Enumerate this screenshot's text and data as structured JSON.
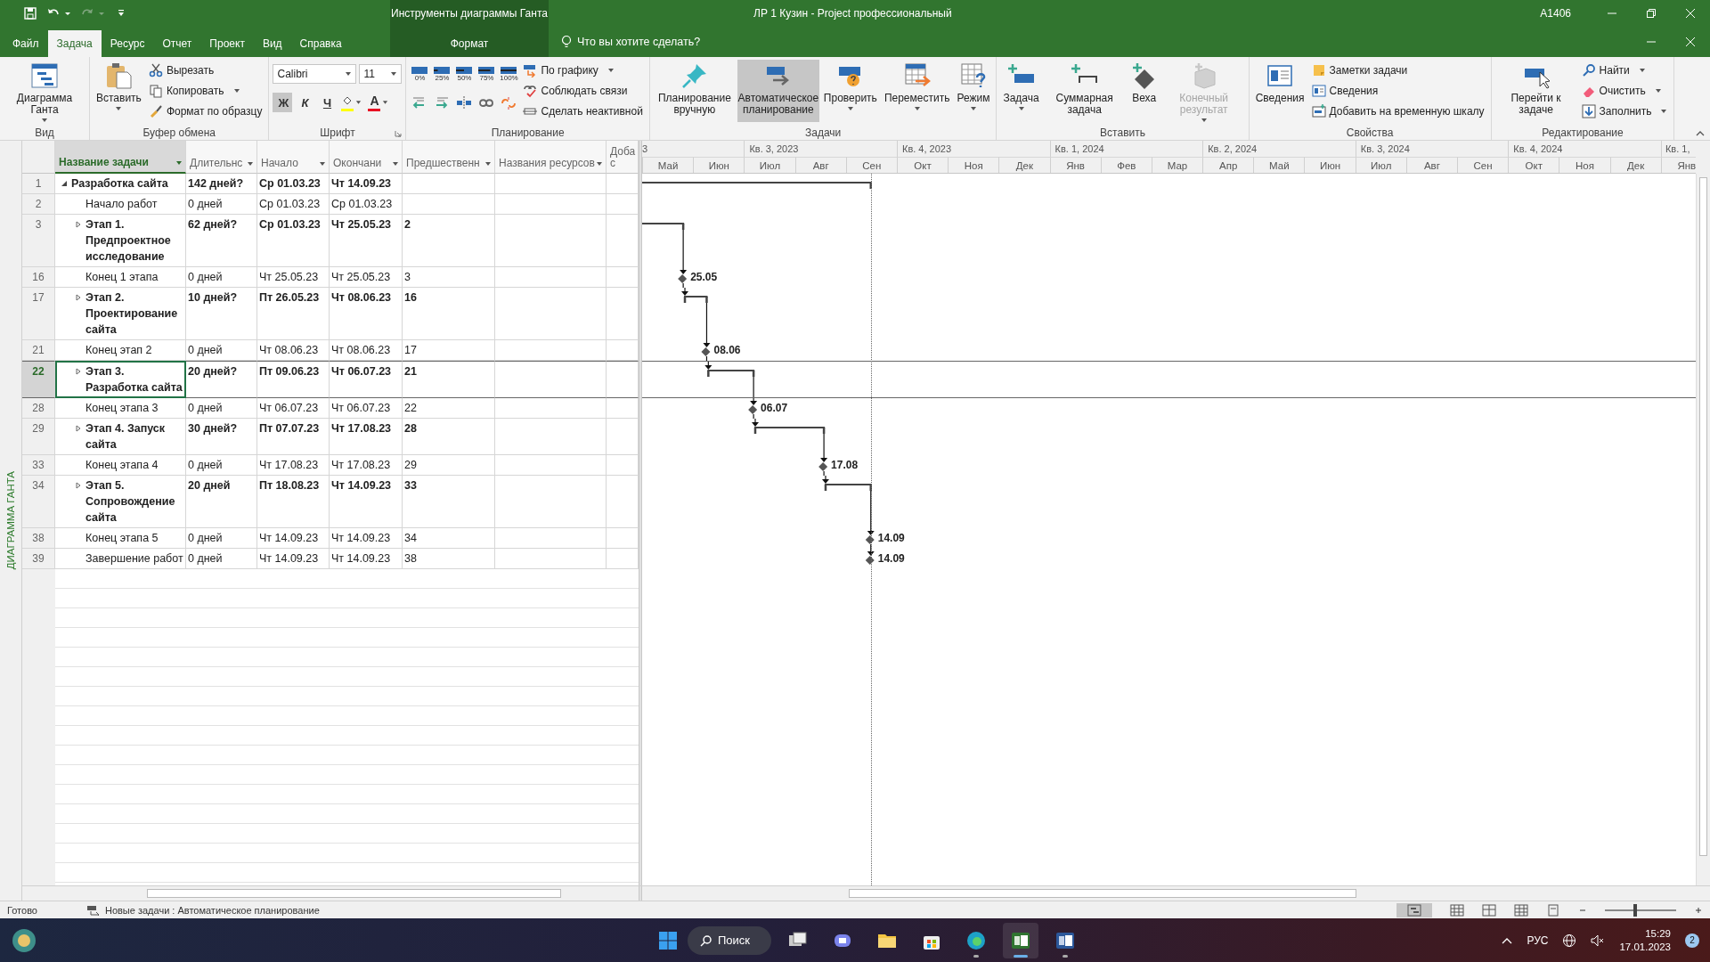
{
  "title_bar": {
    "context_group": "Инструменты диаграммы Ганта",
    "title": "ЛР 1 Кузин  -  Project профессиональный",
    "user": "A1406"
  },
  "tabs": [
    {
      "label": "Файл",
      "selected": false
    },
    {
      "label": "Задача",
      "selected": true
    },
    {
      "label": "Ресурс",
      "selected": false
    },
    {
      "label": "Отчет",
      "selected": false
    },
    {
      "label": "Проект",
      "selected": false
    },
    {
      "label": "Вид",
      "selected": false
    },
    {
      "label": "Справка",
      "selected": false
    }
  ],
  "context_tab": {
    "label": "Формат"
  },
  "tell_me": {
    "placeholder": "Что вы хотите сделать?"
  },
  "ribbon": {
    "groups": [
      {
        "label": "Вид",
        "items": [
          {
            "kind": "large",
            "label": "Диаграмма Ганта",
            "dropdown": true
          }
        ]
      },
      {
        "label": "Буфер обмена",
        "items": [
          {
            "kind": "large",
            "label": "Вставить",
            "dropdown": true
          },
          {
            "kind": "stack",
            "items": [
              {
                "kind": "small",
                "label": "Вырезать"
              },
              {
                "kind": "small",
                "label": "Копировать",
                "dropdown": true
              },
              {
                "kind": "small",
                "label": "Формат по образцу"
              }
            ]
          }
        ]
      },
      {
        "label": "Шрифт",
        "launcher": true,
        "items": [
          {
            "kind": "stack",
            "items": [
              {
                "kind": "row",
                "items": [
                  {
                    "kind": "combo",
                    "value": "Calibri"
                  },
                  {
                    "kind": "combo",
                    "value": "11"
                  }
                ]
              },
              {
                "kind": "row",
                "items": [
                  {
                    "kind": "toggle",
                    "label": "Ж",
                    "selected": true
                  },
                  {
                    "kind": "toggle",
                    "label": "К",
                    "selected": false
                  },
                  {
                    "kind": "toggle",
                    "label": "Ч",
                    "selected": false
                  },
                  {
                    "kind": "color",
                    "color": "#ffff00"
                  },
                  {
                    "kind": "color",
                    "label": "A",
                    "color": "#e81123"
                  }
                ]
              }
            ]
          }
        ]
      },
      {
        "label": "Планирование",
        "items": [
          {
            "kind": "stack",
            "items": [
              {
                "kind": "row",
                "items": [
                  {
                    "kind": "percent",
                    "label": "0%"
                  },
                  {
                    "kind": "percent",
                    "label": "25%"
                  },
                  {
                    "kind": "percent",
                    "label": "50%"
                  },
                  {
                    "kind": "percent",
                    "label": "75%"
                  },
                  {
                    "kind": "percent",
                    "label": "100%"
                  }
                ]
              },
              {
                "kind": "row",
                "items": [
                  {
                    "kind": "icon"
                  },
                  {
                    "kind": "icon"
                  },
                  {
                    "kind": "icon"
                  },
                  {
                    "kind": "icon"
                  },
                  {
                    "kind": "icon"
                  }
                ]
              }
            ]
          },
          {
            "kind": "stack",
            "items": [
              {
                "kind": "small",
                "label": "По графику",
                "dropdown": true
              },
              {
                "kind": "small",
                "label": "Соблюдать связи"
              },
              {
                "kind": "small",
                "label": "Сделать неактивной"
              }
            ]
          }
        ]
      },
      {
        "label": "Задачи",
        "items": [
          {
            "kind": "large",
            "label": "Планирование вручную",
            "selected": false
          },
          {
            "kind": "large",
            "label": "Автоматическое планирование",
            "selected": true
          },
          {
            "kind": "large",
            "label": "Проверить",
            "dropdown": true,
            "selected": false
          },
          {
            "kind": "large",
            "label": "Переместить",
            "dropdown": true,
            "selected": false
          },
          {
            "kind": "large",
            "label": "Режим",
            "dropdown": true,
            "selected": false
          }
        ]
      },
      {
        "label": "Вставить",
        "items": [
          {
            "kind": "large",
            "label": "Задача",
            "dropdown": true,
            "disabled": false
          },
          {
            "kind": "large",
            "label": "Суммарная задача",
            "disabled": false
          },
          {
            "kind": "large",
            "label": "Веха",
            "disabled": false
          },
          {
            "kind": "large",
            "label": "Конечный результат",
            "dropdown": true,
            "disabled": true
          }
        ]
      },
      {
        "label": "Свойства",
        "items": [
          {
            "kind": "large",
            "label": "Сведения"
          },
          {
            "kind": "stack",
            "items": [
              {
                "kind": "small",
                "label": "Заметки задачи"
              },
              {
                "kind": "small",
                "label": "Сведения"
              },
              {
                "kind": "small",
                "label": "Добавить на временную шкалу"
              }
            ]
          }
        ]
      },
      {
        "label": "Редактирование",
        "items": [
          {
            "kind": "large",
            "label": "Перейти к задаче"
          },
          {
            "kind": "stack",
            "items": [
              {
                "kind": "small",
                "label": "Найти",
                "dropdown": true
              },
              {
                "kind": "small",
                "label": "Очистить",
                "dropdown": true
              },
              {
                "kind": "small",
                "label": "Заполнить",
                "dropdown": true
              }
            ]
          }
        ]
      }
    ]
  },
  "view_bar": {
    "label": "ДИАГРАММА ГАНТА"
  },
  "table": {
    "columns": [
      {
        "label": "Название задачи",
        "selected": true,
        "dropdown": true
      },
      {
        "label": "Длительнс",
        "selected": false,
        "dropdown": true
      },
      {
        "label": "Начало",
        "selected": false,
        "dropdown": true
      },
      {
        "label": "Окончани",
        "selected": false,
        "dropdown": true
      },
      {
        "label": "Предшественн",
        "selected": false,
        "dropdown": true
      },
      {
        "label": "Названия ресурсов",
        "selected": false,
        "dropdown": true
      },
      {
        "label": "Доба с",
        "selected": false
      }
    ],
    "rows": [
      {
        "id": "1",
        "name": "Разработка сайта",
        "duration": "142 дней?",
        "start": "Ср 01.03.23",
        "finish": "Чт 14.09.23",
        "kind": "summary",
        "expanded": true,
        "selected": false,
        "children": [
          {
            "id": "2",
            "name": "Начало работ",
            "duration": "0 дней",
            "start": "Ср 01.03.23",
            "finish": "Ср 01.03.23",
            "kind": "milestone",
            "selected": false
          },
          {
            "id": "3",
            "name": "Этап 1. Предпроектное исследование",
            "duration": "62 дней?",
            "start": "Ср 01.03.23",
            "finish": "Чт 25.05.23",
            "predecessors": "2",
            "kind": "summary",
            "expanded": false,
            "selected": false
          },
          {
            "id": "16",
            "name": "Конец 1 этапа",
            "duration": "0 дней",
            "start": "Чт 25.05.23",
            "finish": "Чт 25.05.23",
            "predecessors": "3",
            "kind": "milestone",
            "gantt_label": "25.05",
            "selected": false
          },
          {
            "id": "17",
            "name": "Этап 2. Проектирование сайта",
            "duration": "10 дней?",
            "start": "Пт 26.05.23",
            "finish": "Чт 08.06.23",
            "predecessors": "16",
            "kind": "summary",
            "expanded": false,
            "selected": false
          },
          {
            "id": "21",
            "name": "Конец этап 2",
            "duration": "0 дней",
            "start": "Чт 08.06.23",
            "finish": "Чт 08.06.23",
            "predecessors": "17",
            "kind": "milestone",
            "gantt_label": "08.06",
            "selected": false
          },
          {
            "id": "22",
            "name": "Этап 3. Разработка сайта",
            "duration": "20 дней?",
            "start": "Пт 09.06.23",
            "finish": "Чт 06.07.23",
            "predecessors": "21",
            "kind": "summary",
            "expanded": false,
            "selected": true
          },
          {
            "id": "28",
            "name": "Конец этапа 3",
            "duration": "0 дней",
            "start": "Чт 06.07.23",
            "finish": "Чт 06.07.23",
            "predecessors": "22",
            "kind": "milestone",
            "gantt_label": "06.07",
            "selected": false
          },
          {
            "id": "29",
            "name": "Этап 4. Запуск сайта",
            "duration": "30 дней?",
            "start": "Пт 07.07.23",
            "finish": "Чт 17.08.23",
            "predecessors": "28",
            "kind": "summary",
            "expanded": false,
            "selected": false
          },
          {
            "id": "33",
            "name": "Конец этапа 4",
            "duration": "0 дней",
            "start": "Чт 17.08.23",
            "finish": "Чт 17.08.23",
            "predecessors": "29",
            "kind": "milestone",
            "gantt_label": "17.08",
            "selected": false
          },
          {
            "id": "34",
            "name": "Этап 5. Сопровождение сайта",
            "duration": "20 дней",
            "start": "Пт 18.08.23",
            "finish": "Чт 14.09.23",
            "predecessors": "33",
            "kind": "summary",
            "expanded": false,
            "selected": false
          },
          {
            "id": "38",
            "name": "Конец этапа 5",
            "duration": "0 дней",
            "start": "Чт 14.09.23",
            "finish": "Чт 14.09.23",
            "predecessors": "34",
            "kind": "milestone",
            "gantt_label": "14.09",
            "selected": false
          },
          {
            "id": "39",
            "name": "Завершение работ",
            "duration": "0 дней",
            "start": "Чт 14.09.23",
            "finish": "Чт 14.09.23",
            "predecessors": "38",
            "kind": "milestone",
            "gantt_label": "14.09",
            "selected": false
          }
        ]
      }
    ]
  },
  "timescale": {
    "quarters": [
      "3",
      "Кв. 3, 2023",
      "Кв. 4, 2023",
      "Кв. 1, 2024",
      "Кв. 2, 2024",
      "Кв. 3, 2024",
      "Кв. 4, 2024",
      "Кв. 1,"
    ],
    "months": [
      "Май",
      "Июн",
      "Июл",
      "Авг",
      "Сен",
      "Окт",
      "Ноя",
      "Дек",
      "Янв",
      "Фев",
      "Мар",
      "Апр",
      "Май",
      "Июн",
      "Июл",
      "Авг",
      "Сен",
      "Окт",
      "Ноя",
      "Дек",
      "Янв"
    ]
  },
  "status_bar": {
    "ready": "Готово",
    "mode": "Новые задачи : Автоматическое планирование",
    "zoom": {
      "level": 0.42
    }
  },
  "taskbar": {
    "search": "Поиск",
    "language": "РУС",
    "time": "15:29",
    "date": "17.01.2023",
    "notifications": "2",
    "apps": [
      {
        "selected": false,
        "running": false
      },
      {
        "selected": false,
        "running": false
      },
      {
        "selected": false,
        "running": false
      },
      {
        "selected": false,
        "running": false
      },
      {
        "selected": false,
        "running": true
      },
      {
        "selected": true,
        "running": true
      },
      {
        "selected": false,
        "running": true
      }
    ]
  }
}
